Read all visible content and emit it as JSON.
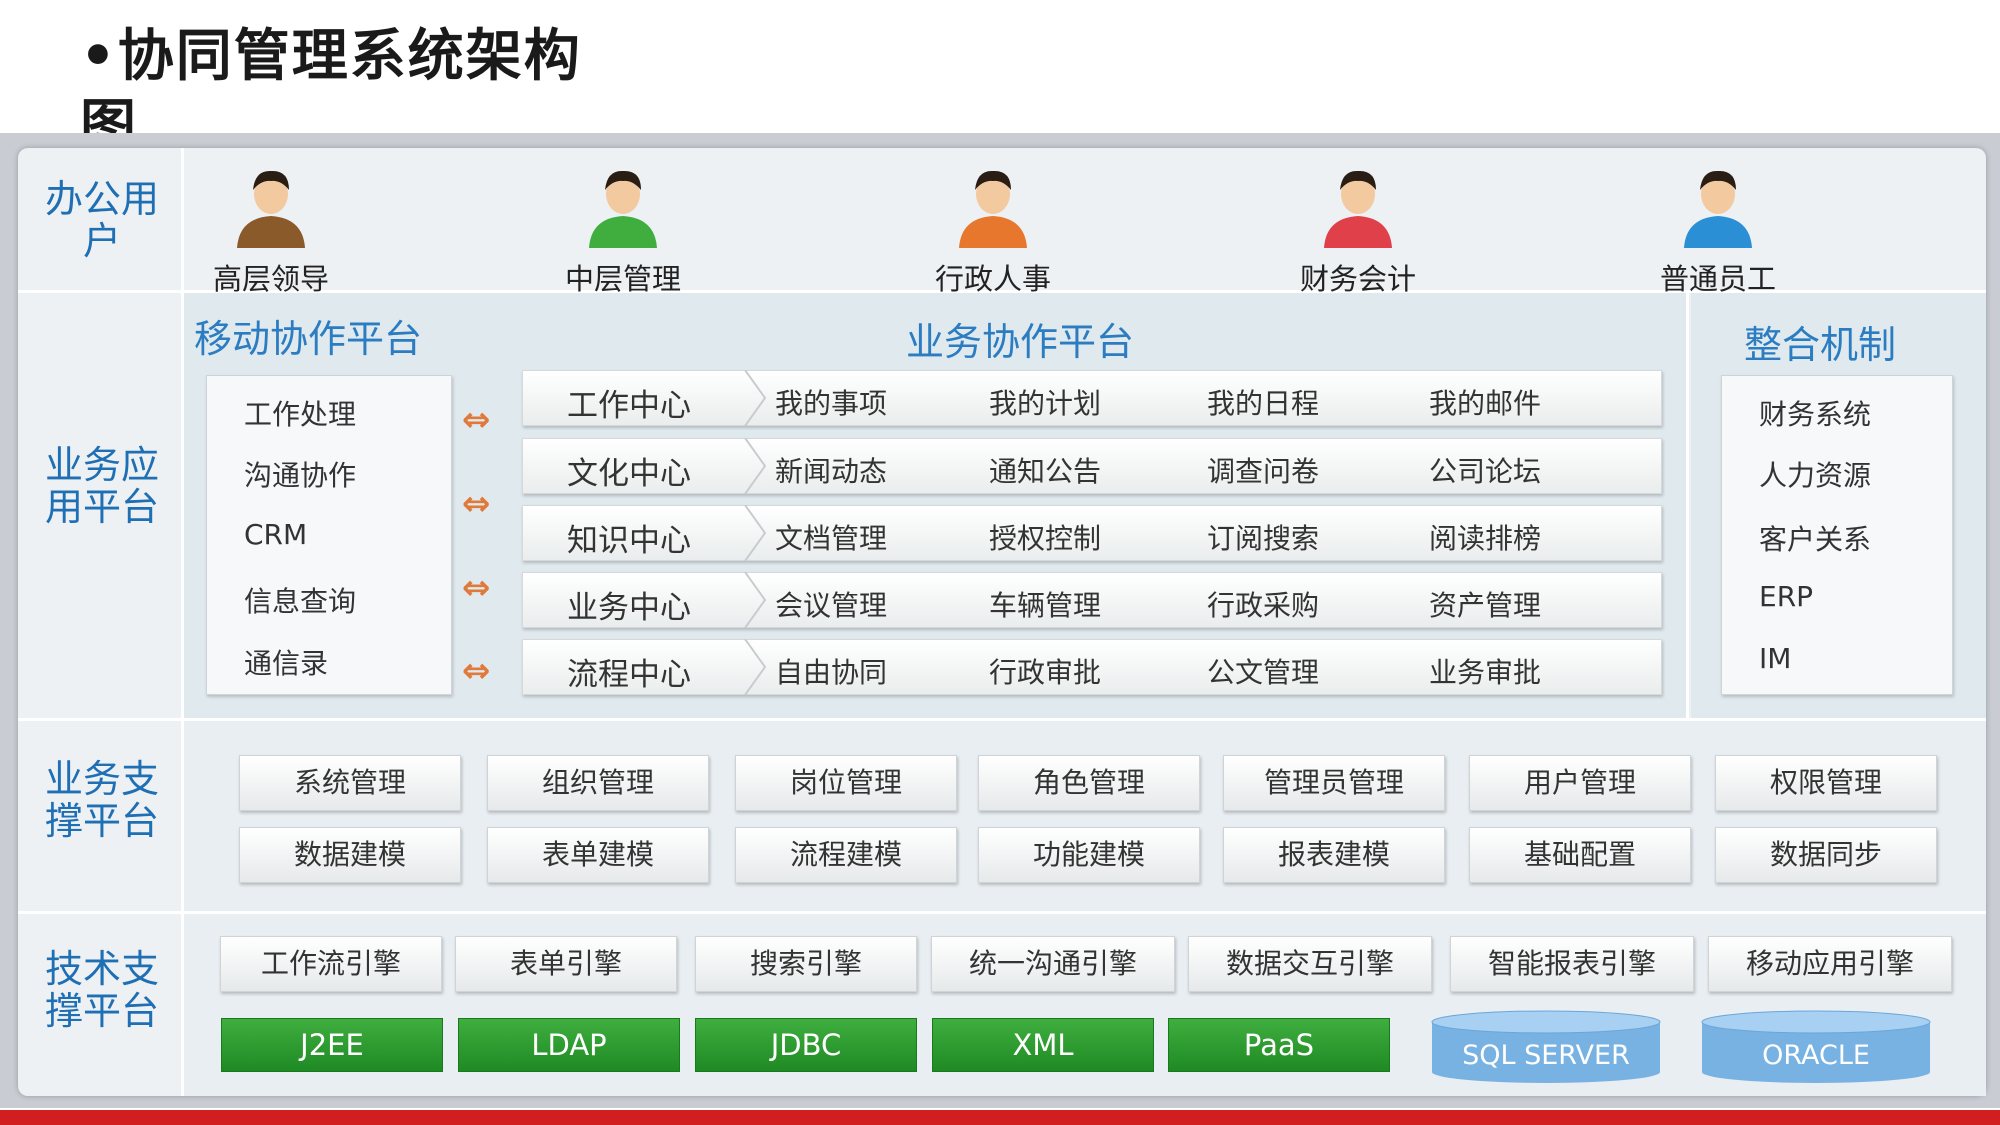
{
  "title": "•协同管理系统架构图",
  "rows": {
    "office_users": "办公用户",
    "business_app": "业务应用平台",
    "business_support": "业务支撑平台",
    "tech_support": "技术支撑平台"
  },
  "users": [
    {
      "name": "高层领导",
      "icon": "senior-leader-avatar",
      "color": "#8a5a2b"
    },
    {
      "name": "中层管理",
      "icon": "middle-manager-avatar",
      "color": "#3fae3f"
    },
    {
      "name": "行政人事",
      "icon": "admin-hr-avatar",
      "color": "#e8772e"
    },
    {
      "name": "财务会计",
      "icon": "finance-accountant-avatar",
      "color": "#e0404a"
    },
    {
      "name": "普通员工",
      "icon": "employee-avatar",
      "color": "#2b8fd6"
    }
  ],
  "mobile": {
    "title": "移动协作平台",
    "items": [
      "工作处理",
      "沟通协作",
      "CRM",
      "信息查询",
      "通信录"
    ]
  },
  "business": {
    "title": "业务协作平台",
    "rows": [
      {
        "center": "工作中心",
        "items": [
          "我的事项",
          "我的计划",
          "我的日程",
          "我的邮件"
        ]
      },
      {
        "center": "文化中心",
        "items": [
          "新闻动态",
          "通知公告",
          "调查问卷",
          "公司论坛"
        ]
      },
      {
        "center": "知识中心",
        "items": [
          "文档管理",
          "授权控制",
          "订阅搜索",
          "阅读排榜"
        ]
      },
      {
        "center": "业务中心",
        "items": [
          "会议管理",
          "车辆管理",
          "行政采购",
          "资产管理"
        ]
      },
      {
        "center": "流程中心",
        "items": [
          "自由协同",
          "行政审批",
          "公文管理",
          "业务审批"
        ]
      }
    ]
  },
  "integration": {
    "title": "整合机制",
    "items": [
      "财务系统",
      "人力资源",
      "客户关系",
      "ERP",
      "IM"
    ]
  },
  "support": {
    "row1": [
      "系统管理",
      "组织管理",
      "岗位管理",
      "角色管理",
      "管理员管理",
      "用户管理",
      "权限管理"
    ],
    "row2": [
      "数据建模",
      "表单建模",
      "流程建模",
      "功能建模",
      "报表建模",
      "基础配置",
      "数据同步"
    ]
  },
  "tech": {
    "engines": [
      "工作流引擎",
      "表单引擎",
      "搜索引擎",
      "统一沟通引擎",
      "数据交互引擎",
      "智能报表引擎",
      "移动应用引擎"
    ],
    "techs": [
      "J2EE",
      "LDAP",
      "JDBC",
      "XML",
      "PaaS"
    ],
    "dbs": [
      "SQL SERVER",
      "ORACLE"
    ]
  },
  "colors": {
    "accent": "#1f6fb4",
    "green": "#2a9a2e",
    "cylinder": "#7fb7e6",
    "red_bar": "#d11f1f"
  }
}
